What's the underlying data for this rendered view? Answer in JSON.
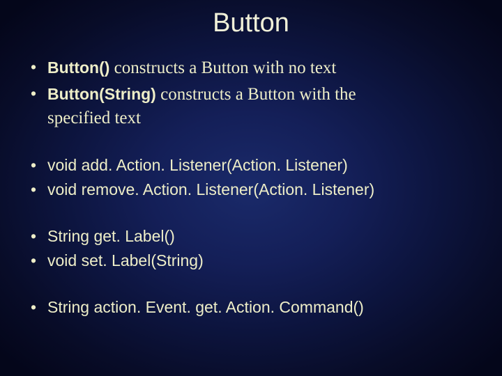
{
  "title": "Button",
  "groups": [
    [
      {
        "bold": "Button()",
        "serif_tail": " constructs a Button with no text"
      },
      {
        "bold": "Button(String)",
        "serif_tail": " constructs a Button with the",
        "cont": "specified text"
      }
    ],
    [
      {
        "plain": "void add. Action. Listener(Action. Listener)"
      },
      {
        "plain": "void remove. Action. Listener(Action. Listener)"
      }
    ],
    [
      {
        "plain": "String get. Label()"
      },
      {
        "plain": "void set. Label(String)"
      }
    ],
    [
      {
        "plain": "String action. Event. get. Action. Command()"
      }
    ]
  ]
}
